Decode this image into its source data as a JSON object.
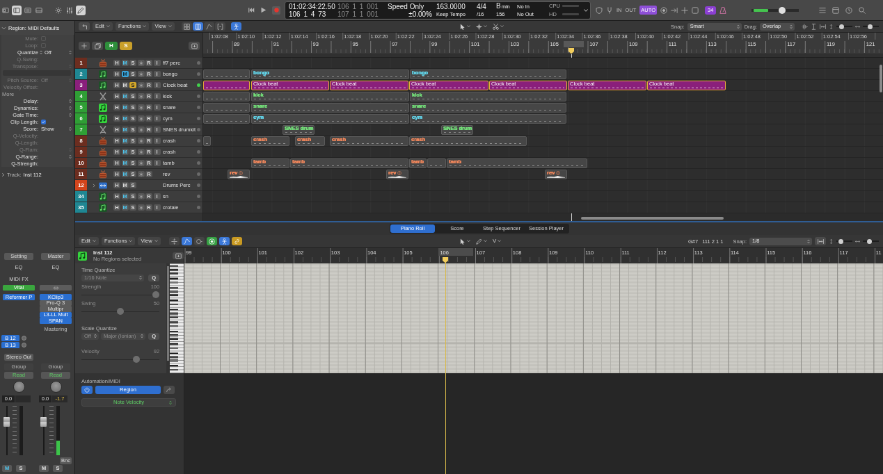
{
  "control_bar": {
    "view_buttons": [
      {
        "selected": false
      },
      {
        "selected": true
      },
      {
        "selected": false
      },
      {
        "selected": false
      }
    ],
    "edit_buttons": [
      {
        "selected": false
      },
      {
        "selected": false
      },
      {
        "selected": true
      }
    ],
    "lcd": {
      "time": "01:02:34:22.50",
      "bars": "106 1 4 73",
      "left_locator": "106 1 1 001",
      "right_locator": "107 1 1 001",
      "varispeed_mode": "Speed Only",
      "varispeed": "±0.00%",
      "tempo": "163.0000",
      "tempo_mode": "Keep Tempo",
      "time_signature": "4/4",
      "division": "/16",
      "key": "B",
      "key_mode": "min",
      "number": "156",
      "midi_in": "No In",
      "midi_out": "No Out",
      "cpu_label": "CPU",
      "hd_label": "HD"
    },
    "in_label": "IN",
    "out_label": "OUT",
    "automation_button": {
      "label": "AUTO",
      "on": true
    },
    "badge": "34",
    "master_volume": {
      "level": 0.67,
      "meter": {
        "level": 0.3
      }
    }
  },
  "region_inspector": {
    "title": "Region: MIDI Defaults",
    "expanded": true,
    "rows": [
      {
        "label": "Mute:",
        "kind": "checkbox",
        "checked": false,
        "dimmed": true
      },
      {
        "label": "Loop:",
        "kind": "checkbox",
        "checked": false,
        "dimmed": true
      },
      {
        "label": "Quantize",
        "kind": "menu",
        "value": "Off",
        "dimmed": false
      },
      {
        "label": "Q-Swing:",
        "kind": "text",
        "dimmed": true
      },
      {
        "label": "Transpose:",
        "kind": "stepper",
        "dimmed": true
      },
      {
        "kind": "field"
      },
      {
        "label": "Pitch Source:",
        "kind": "stepper",
        "value": "Off",
        "dimmed": true
      },
      {
        "label": "Velocity Offset:",
        "kind": "text",
        "dimmed": true
      },
      {
        "label": "More",
        "kind": "section"
      },
      {
        "label": "Delay:",
        "kind": "stepper",
        "dimmed": false
      },
      {
        "label": "Dynamics:",
        "kind": "stepper",
        "dimmed": false
      },
      {
        "label": "Gate Time:",
        "kind": "stepper",
        "dimmed": false
      },
      {
        "label": "Clip Length:",
        "kind": "checkbox",
        "checked": true,
        "dimmed": false
      },
      {
        "label": "Score:",
        "kind": "stepper",
        "value": "Show",
        "dimmed": false
      },
      {
        "label": "Q-Velocity:",
        "kind": "text",
        "dimmed": true
      },
      {
        "label": "Q-Length:",
        "kind": "text",
        "dimmed": true
      },
      {
        "label": "Q-Flam:",
        "kind": "stepper",
        "dimmed": true
      },
      {
        "label": "Q-Range:",
        "kind": "stepper",
        "dimmed": false
      },
      {
        "label": "Q-Strength:",
        "kind": "text",
        "dimmed": false
      }
    ]
  },
  "track_inspector": {
    "label": "Track:",
    "value": "Inst 112",
    "expanded": false
  },
  "channel_strips": [
    {
      "setting": "Setting",
      "eq": "EQ",
      "midi_fx": "MIDI FX",
      "instrument": "Vital",
      "plugins": [
        {
          "label": "Reformer P",
          "on": true
        }
      ],
      "sends": [
        {
          "label": "B 12"
        },
        {
          "label": "B 13"
        }
      ],
      "output": "Stereo Out",
      "group": "Group",
      "automation": "Read",
      "volume": "0.0",
      "fader": {
        "level": 0.72
      },
      "mute": {
        "label": "M",
        "on": false,
        "implied": true
      },
      "solo": {
        "label": "S",
        "on": false
      }
    },
    {
      "setting": "Master",
      "eq": "EQ",
      "link": true,
      "plugins": [
        {
          "label": "KClip3",
          "on": true
        },
        {
          "label": "Pro-Q 3",
          "on": false
        },
        {
          "label": "Multipr",
          "on": false
        },
        {
          "label": "L3-LL Mult",
          "on": true
        },
        {
          "label": "SPAN",
          "on": true
        }
      ],
      "name": "Mastering",
      "group": "Group",
      "automation": "Read",
      "volume": "0.0",
      "peak": "-1.7",
      "fader": {
        "level": 0.72
      },
      "meter": {
        "level": 0.3
      },
      "bounce": "Bnc",
      "mute": {
        "label": "M",
        "on": false,
        "implied": false
      },
      "solo": {
        "label": "S",
        "on": false
      }
    }
  ],
  "tracks_area": {
    "menus": [
      "Edit",
      "Functions",
      "View"
    ],
    "view_toggles": [
      {
        "selected": false
      },
      {
        "selected": true
      },
      {
        "selected": false
      },
      {
        "selected": false
      },
      {
        "selected": true
      }
    ],
    "snap_label": "Snap:",
    "snap_value": "Smart",
    "drag_label": "Drag:",
    "drag_value": "Overlap",
    "zoom_sliders": [
      {
        "level": 0.25
      },
      {
        "level": 0.45
      }
    ],
    "hide_button": {
      "label": "H",
      "on": true
    },
    "solo_button": {
      "label": "S",
      "on": true
    },
    "time_labels": [
      "1:02:08",
      "1:02:10",
      "1:02:12",
      "1:02:14",
      "1:02:16",
      "1:02:18",
      "1:02:20",
      "1:02:22",
      "1:02:24",
      "1:02:26",
      "1:02:28",
      "1:02:30",
      "1:02:32",
      "1:02:34",
      "1:02:36",
      "1:02:38",
      "1:02:40",
      "1:02:42",
      "1:02:44",
      "1:02:46",
      "1:02:48",
      "1:02:50",
      "1:02:52",
      "1:02:54",
      "1:02:56"
    ],
    "bar_numbers": [
      "89",
      "91",
      "93",
      "95",
      "97",
      "99",
      "101",
      "103",
      "105",
      "107",
      "109",
      "111",
      "113",
      "115",
      "117",
      "119",
      "121"
    ],
    "tracks": [
      {
        "number": "1",
        "name": "ff7 perc",
        "color": "#6c2d1f",
        "kind": "kit",
        "activity": false,
        "buttons": [
          {
            "kind": "hide",
            "label": "H"
          },
          {
            "kind": "mute",
            "label": "M",
            "on": false,
            "implied": true
          },
          {
            "kind": "solo",
            "label": "S",
            "on": false
          },
          {
            "kind": "freeze"
          },
          {
            "kind": "record",
            "label": "R"
          },
          {
            "kind": "input",
            "label": "I"
          }
        ]
      },
      {
        "number": "2",
        "name": "bongo",
        "color": "#1f8793",
        "kind": "note",
        "activity": false,
        "buttons": [
          {
            "kind": "hide",
            "label": "H"
          },
          {
            "kind": "mute",
            "label": "M",
            "on": true
          },
          {
            "kind": "solo",
            "label": "S",
            "on": false
          },
          {
            "kind": "freeze"
          },
          {
            "kind": "record",
            "label": "R"
          },
          {
            "kind": "input",
            "label": "I"
          }
        ],
        "regions": [
          {
            "kind": "midi",
            "selected": false
          },
          {
            "kind": "midi",
            "name": "bongo",
            "color": "#62d3e8",
            "selected": false
          },
          {
            "kind": "midi",
            "name": "bongo",
            "color": "#62d3e8",
            "selected": false
          }
        ]
      },
      {
        "number": "3",
        "name": "Clock beat",
        "color": "#8a1f7b",
        "kind": "note",
        "activity": true,
        "buttons": [
          {
            "kind": "hide",
            "label": "H"
          },
          {
            "kind": "mute",
            "label": "M",
            "on": false,
            "implied": false
          },
          {
            "kind": "solo",
            "label": "S",
            "on": true
          },
          {
            "kind": "freeze"
          },
          {
            "kind": "record",
            "label": "R"
          },
          {
            "kind": "input",
            "label": "I"
          }
        ],
        "regions": [
          {
            "kind": "solid",
            "color": "#8a1f7b",
            "selected": true
          },
          {
            "kind": "solid",
            "name": "Clock beat",
            "color": "#8a1f7b",
            "selected": true
          },
          {
            "kind": "solid",
            "name": "Clock beat",
            "color": "#8a1f7b",
            "selected": true
          },
          {
            "kind": "solid",
            "name": "Clock beat",
            "color": "#8a1f7b",
            "selected": true
          },
          {
            "kind": "solid",
            "name": "Clock beat",
            "color": "#8a1f7b",
            "selected": true
          },
          {
            "kind": "solid",
            "name": "Clock beat",
            "color": "#8a1f7b",
            "selected": true
          },
          {
            "kind": "solid",
            "name": "Clock beat",
            "color": "#8a1f7b",
            "selected": true
          }
        ]
      },
      {
        "number": "4",
        "name": "kick",
        "color": "#2f9f35",
        "kind": "sticks",
        "activity": false,
        "buttons": [
          {
            "kind": "hide",
            "label": "H"
          },
          {
            "kind": "mute",
            "label": "M",
            "on": false,
            "implied": true
          },
          {
            "kind": "solo",
            "label": "S",
            "on": false
          },
          {
            "kind": "freeze"
          },
          {
            "kind": "record",
            "label": "R"
          },
          {
            "kind": "input",
            "label": "I"
          }
        ],
        "regions": [
          {
            "kind": "midi",
            "selected": false
          },
          {
            "kind": "midi",
            "name": "kick",
            "color": "#74e07a",
            "selected": false
          },
          {
            "kind": "midi",
            "name": "kick",
            "color": "#74e07a",
            "selected": false
          }
        ]
      },
      {
        "number": "5",
        "name": "snare",
        "color": "#2f9f35",
        "kind": "glow",
        "activity": false,
        "buttons": [
          {
            "kind": "hide",
            "label": "H"
          },
          {
            "kind": "mute",
            "label": "M",
            "on": false,
            "implied": true
          },
          {
            "kind": "solo",
            "label": "S",
            "on": false
          },
          {
            "kind": "freeze"
          },
          {
            "kind": "record",
            "label": "R"
          },
          {
            "kind": "input",
            "label": "I"
          }
        ],
        "regions": [
          {
            "kind": "midi",
            "selected": false
          },
          {
            "kind": "midi",
            "name": "snare",
            "color": "#74e07a",
            "selected": false
          },
          {
            "kind": "midi",
            "name": "snare",
            "color": "#74e07a",
            "selected": false
          }
        ]
      },
      {
        "number": "6",
        "name": "cym",
        "color": "#2f9f35",
        "kind": "glow",
        "activity": false,
        "buttons": [
          {
            "kind": "hide",
            "label": "H"
          },
          {
            "kind": "mute",
            "label": "M",
            "on": false,
            "implied": true
          },
          {
            "kind": "solo",
            "label": "S",
            "on": false
          },
          {
            "kind": "freeze"
          },
          {
            "kind": "record",
            "label": "R"
          },
          {
            "kind": "input",
            "label": "I"
          }
        ],
        "regions": [
          {
            "kind": "midi",
            "selected": false
          },
          {
            "kind": "midi",
            "name": "cym",
            "color": "#62d3e8",
            "selected": false
          },
          {
            "kind": "midi",
            "name": "cym",
            "color": "#62d3e8",
            "selected": false
          }
        ]
      },
      {
        "number": "7",
        "name": "SNES drumkit",
        "color": "#2f9f35",
        "kind": "sticks",
        "activity": false,
        "buttons": [
          {
            "kind": "hide",
            "label": "H"
          },
          {
            "kind": "mute",
            "label": "M",
            "on": false,
            "implied": true
          },
          {
            "kind": "solo",
            "label": "S",
            "on": false
          },
          {
            "kind": "freeze"
          },
          {
            "kind": "record",
            "label": "R"
          },
          {
            "kind": "input",
            "label": "I"
          }
        ],
        "regions": [
          {
            "kind": "midi",
            "name": "SNES drum",
            "color": "#74e07a",
            "selected": false
          },
          {
            "kind": "midi",
            "name": "SNES drum",
            "color": "#74e07a",
            "selected": false
          }
        ]
      },
      {
        "number": "8",
        "name": "crash",
        "color": "#6c2d1f",
        "kind": "kit",
        "activity": false,
        "buttons": [
          {
            "kind": "hide",
            "label": "H"
          },
          {
            "kind": "mute",
            "label": "M",
            "on": false,
            "implied": true
          },
          {
            "kind": "solo",
            "label": "S",
            "on": false
          },
          {
            "kind": "freeze"
          },
          {
            "kind": "record",
            "label": "R"
          },
          {
            "kind": "input",
            "label": "I"
          }
        ],
        "regions": [
          {
            "kind": "midi",
            "selected": false
          },
          {
            "kind": "midi",
            "name": "crash",
            "color": "#f0875c",
            "selected": false
          },
          {
            "kind": "midi",
            "name": "crash",
            "color": "#f0875c",
            "selected": false
          },
          {
            "kind": "midi",
            "name": "crash",
            "color": "#f0875c",
            "selected": false
          },
          {
            "kind": "midi",
            "name": "crash",
            "color": "#f0875c",
            "selected": false
          }
        ]
      },
      {
        "number": "9",
        "name": "crash",
        "color": "#6c2d1f",
        "kind": "kit",
        "activity": false,
        "buttons": [
          {
            "kind": "hide",
            "label": "H"
          },
          {
            "kind": "mute",
            "label": "M",
            "on": false,
            "implied": true
          },
          {
            "kind": "solo",
            "label": "S",
            "on": false
          },
          {
            "kind": "freeze"
          },
          {
            "kind": "record",
            "label": "R"
          },
          {
            "kind": "input",
            "label": "I"
          }
        ]
      },
      {
        "number": "10",
        "name": "tamb",
        "color": "#6c2d1f",
        "kind": "kit",
        "activity": false,
        "buttons": [
          {
            "kind": "hide",
            "label": "H"
          },
          {
            "kind": "mute",
            "label": "M",
            "on": false,
            "implied": true
          },
          {
            "kind": "solo",
            "label": "S",
            "on": false
          },
          {
            "kind": "freeze"
          },
          {
            "kind": "record",
            "label": "R"
          },
          {
            "kind": "input",
            "label": "I"
          }
        ],
        "regions": [
          {
            "kind": "midi",
            "name": "tamb",
            "color": "#f0875c",
            "selected": false
          },
          {
            "kind": "midi",
            "name": "tamb",
            "color": "#f0875c",
            "selected": false
          },
          {
            "kind": "midi",
            "name": "tamb",
            "color": "#f0875c",
            "selected": false
          },
          {
            "kind": "midi",
            "selected": false
          },
          {
            "kind": "midi",
            "name": "tamb",
            "color": "#f0875c",
            "selected": false
          }
        ]
      },
      {
        "number": "11",
        "name": "rev",
        "color": "#6c2d1f",
        "kind": "kit",
        "activity": false,
        "buttons": [
          {
            "kind": "hide",
            "label": "H"
          },
          {
            "kind": "mute",
            "label": "M",
            "on": false,
            "implied": true
          },
          {
            "kind": "solo",
            "label": "S",
            "on": false
          },
          {
            "kind": "freeze"
          },
          {
            "kind": "record",
            "label": "R"
          }
        ],
        "regions": [
          {
            "kind": "audio",
            "name": "rev",
            "color": "#f0875c",
            "selected": false
          },
          {
            "kind": "audio",
            "name": "rev",
            "color": "#f0875c",
            "selected": false
          },
          {
            "kind": "audio",
            "name": "rev",
            "color": "#f0875c",
            "selected": false
          }
        ]
      },
      {
        "number": "12",
        "name": "Drums Perc",
        "color": "#d4451c",
        "kind": "stack",
        "expanded": false,
        "activity": false,
        "buttons": [
          {
            "kind": "hide",
            "label": "H"
          },
          {
            "kind": "mute",
            "label": "M",
            "on": false,
            "implied": false
          },
          {
            "kind": "solo",
            "label": "S",
            "on": false
          }
        ]
      },
      {
        "number": "34",
        "name": "sn",
        "color": "#1f8793",
        "kind": "note",
        "activity": false,
        "buttons": [
          {
            "kind": "hide",
            "label": "H"
          },
          {
            "kind": "mute",
            "label": "M",
            "on": false,
            "implied": true
          },
          {
            "kind": "solo",
            "label": "S",
            "on": false
          },
          {
            "kind": "freeze"
          },
          {
            "kind": "record",
            "label": "R"
          },
          {
            "kind": "input",
            "label": "I"
          }
        ]
      },
      {
        "number": "35",
        "name": "crotale",
        "color": "#1f8793",
        "kind": "note",
        "activity": false,
        "buttons": [
          {
            "kind": "hide",
            "label": "H"
          },
          {
            "kind": "mute",
            "label": "M",
            "on": false,
            "implied": true
          },
          {
            "kind": "solo",
            "label": "S",
            "on": false
          },
          {
            "kind": "freeze"
          },
          {
            "kind": "record",
            "label": "R"
          },
          {
            "kind": "input",
            "label": "I"
          }
        ]
      }
    ]
  },
  "editor": {
    "tabs": [
      {
        "label": "Piano Roll",
        "selected": true
      },
      {
        "label": "Score",
        "selected": false
      },
      {
        "label": "Step Sequencer",
        "selected": false
      },
      {
        "label": "Session Player",
        "selected": false
      }
    ],
    "menus": [
      "Edit",
      "Functions",
      "View"
    ],
    "toggles": [
      {
        "selected": false
      },
      {
        "selected": true
      },
      {
        "selected": false
      },
      {
        "selected": true
      },
      {
        "selected": true
      },
      {
        "selected": true
      }
    ],
    "velocity_tool": "V",
    "pitch": "G#7",
    "position": "111 2 1 1",
    "snap_label": "Snap:",
    "snap_value": "1/8",
    "zoom_sliders": [
      {
        "level": 0.2
      },
      {
        "level": 0.4
      }
    ],
    "region_name": "Inst 112",
    "region_status": "No Regions selected",
    "time_quantize": {
      "title": "Time Quantize",
      "value": "1/16 Note",
      "button": "Q"
    },
    "strength": {
      "label": "Strength",
      "value": "100",
      "level": 1
    },
    "swing": {
      "label": "Swing",
      "value": "50",
      "level": 0.5
    },
    "scale_quantize": {
      "title": "Scale Quantize",
      "mode": "Off",
      "scale": "Major (Ionian)",
      "button": "Q"
    },
    "velocity": {
      "label": "Velocity",
      "value": "92",
      "level": 0.72
    },
    "automation": {
      "title": "Automation/MIDI",
      "on": true,
      "mode": "Region",
      "parameter": "Note Velocity"
    },
    "bar_numbers": [
      "99",
      "100",
      "101",
      "102",
      "103",
      "104",
      "105",
      "106",
      "107",
      "108",
      "109",
      "110",
      "111",
      "112",
      "113",
      "114",
      "115",
      "116",
      "117",
      "11"
    ]
  }
}
